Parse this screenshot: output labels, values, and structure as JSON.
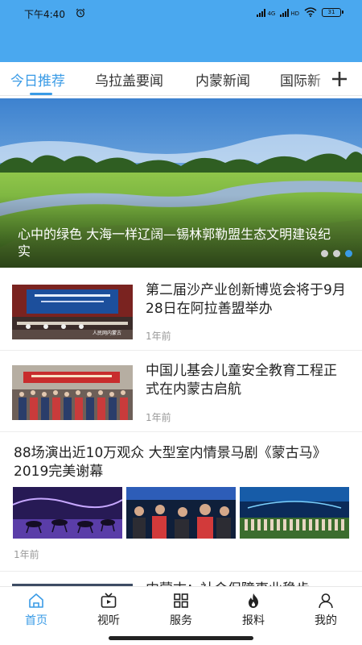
{
  "status_bar": {
    "time": "下午4:40",
    "signal_1_label": "4G",
    "signal_2_label": "HD",
    "battery": "31"
  },
  "tabs": [
    {
      "label": "今日推荐",
      "active": true
    },
    {
      "label": "乌拉盖要闻",
      "active": false
    },
    {
      "label": "内蒙新闻",
      "active": false
    },
    {
      "label": "国际新",
      "active": false
    }
  ],
  "banner": {
    "caption": "心中的绿色  大海一样辽阔—锡林郭勒盟生态文明建设纪实",
    "slide_count": 3,
    "active_slide": 3
  },
  "feed": [
    {
      "title": "第二届沙产业创新博览会将于9月28日在阿拉善盟举办",
      "time": "1年前",
      "thumb_mark": "人民网内蒙古"
    },
    {
      "title": "中国儿基会儿童安全教育工程正式在内蒙古启航",
      "time": "1年前"
    },
    {
      "title": "88场演出近10万观众  大型室内情景马剧《蒙古马》2019完美谢幕",
      "time": "1年前"
    },
    {
      "title": "内蒙古：社会保障事业稳步"
    }
  ],
  "bottom_nav": [
    {
      "label": "首页",
      "icon": "home-icon",
      "active": true
    },
    {
      "label": "视听",
      "icon": "tv-icon",
      "active": false
    },
    {
      "label": "服务",
      "icon": "grid-icon",
      "active": false
    },
    {
      "label": "报料",
      "icon": "fire-icon",
      "active": false
    },
    {
      "label": "我的",
      "icon": "user-icon",
      "active": false
    }
  ],
  "colors": {
    "header": "#4aa8ef",
    "accent": "#3a9be6"
  }
}
